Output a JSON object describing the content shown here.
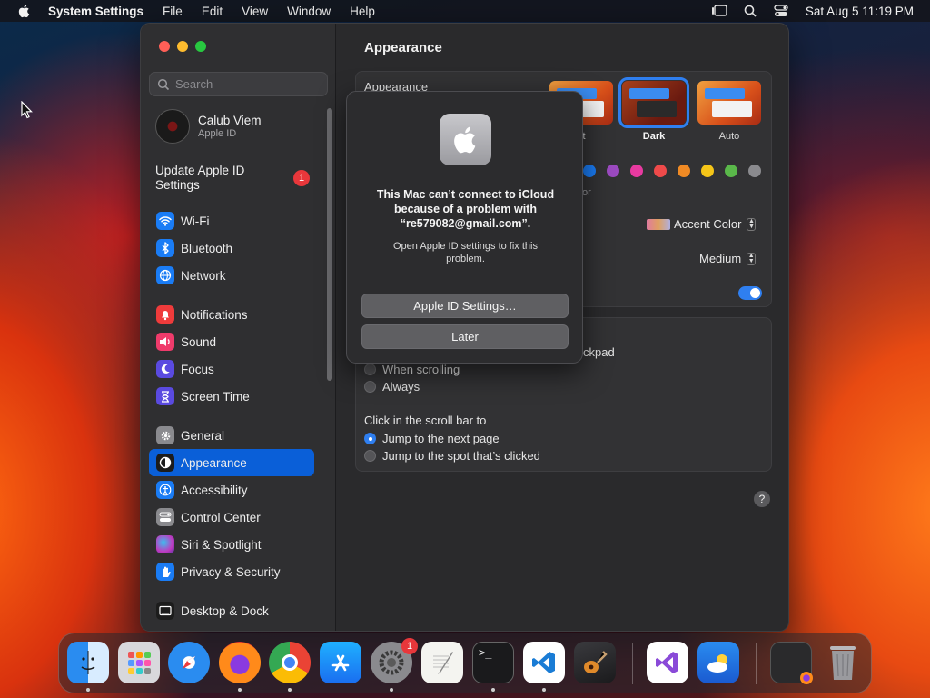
{
  "menubar": {
    "app_name": "System Settings",
    "menus": [
      "File",
      "Edit",
      "View",
      "Window",
      "Help"
    ],
    "clock": "Sat Aug 5  11:19 PM"
  },
  "sidebar": {
    "search_placeholder": "Search",
    "account": {
      "name": "Calub Viem",
      "subtitle": "Apple ID"
    },
    "update": {
      "label": "Update Apple ID Settings",
      "badge": "1"
    },
    "items": [
      {
        "label": "Wi-Fi",
        "icon": "wifi-icon",
        "color": "#1a7cf5"
      },
      {
        "label": "Bluetooth",
        "icon": "bluetooth-icon",
        "color": "#1a7cf5"
      },
      {
        "label": "Network",
        "icon": "globe-icon",
        "color": "#1a7cf5"
      },
      {
        "label": "Notifications",
        "icon": "bell-icon",
        "color": "#ef3b3b"
      },
      {
        "label": "Sound",
        "icon": "speaker-icon",
        "color": "#ef3b6b"
      },
      {
        "label": "Focus",
        "icon": "moon-icon",
        "color": "#5a4ae0"
      },
      {
        "label": "Screen Time",
        "icon": "hourglass-icon",
        "color": "#5a4ae0"
      },
      {
        "label": "General",
        "icon": "gear-icon",
        "color": "#8a8a8e"
      },
      {
        "label": "Appearance",
        "icon": "appearance-icon",
        "color": "#1c1c1c"
      },
      {
        "label": "Accessibility",
        "icon": "accessibility-icon",
        "color": "#1a7cf5"
      },
      {
        "label": "Control Center",
        "icon": "control-center-icon",
        "color": "#8a8a8e"
      },
      {
        "label": "Siri & Spotlight",
        "icon": "siri-icon",
        "color": "#c03ac0"
      },
      {
        "label": "Privacy & Security",
        "icon": "hand-icon",
        "color": "#1a7cf5"
      },
      {
        "label": "Desktop & Dock",
        "icon": "desktop-icon",
        "color": "#1c1c1c"
      }
    ],
    "active_item": "Appearance"
  },
  "main": {
    "title": "Appearance",
    "appearance_label": "Appearance",
    "options": [
      "Light",
      "Dark",
      "Auto"
    ],
    "selected_option": "Dark",
    "option_label_partial": "nt",
    "accent_colors": [
      "#1a7cf5",
      "#9b4ac0",
      "#e83aa0",
      "#ef4a4a",
      "#f08a24",
      "#f5c518",
      "#5ab84a",
      "#8a8a8e"
    ],
    "accent_partial_text": "or",
    "accent_color_label": "Accent Color",
    "sidebar_icon_size": "Medium",
    "scroll_partial": "ckpad",
    "scroll_options": [
      "When scrolling",
      "Always"
    ],
    "click_label": "Click in the scroll bar to",
    "click_options": [
      "Jump to the next page",
      "Jump to the spot that’s clicked"
    ],
    "click_selected": "Jump to the next page",
    "help": "?"
  },
  "alert": {
    "heading": "This Mac can’t connect to iCloud because of a problem with “re579082@gmail.com”.",
    "body": "Open Apple ID settings to fix this problem.",
    "primary_button": "Apple ID Settings…",
    "secondary_button": "Later"
  },
  "dock": {
    "apps": [
      "Finder",
      "Launchpad",
      "Safari",
      "Firefox",
      "Chrome",
      "App Store",
      "System Settings",
      "TextEdit",
      "Terminal",
      "VS Code",
      "GarageBand",
      "Visual Studio",
      "Weather",
      "Window Preview",
      "Trash"
    ],
    "settings_badge": "1"
  }
}
